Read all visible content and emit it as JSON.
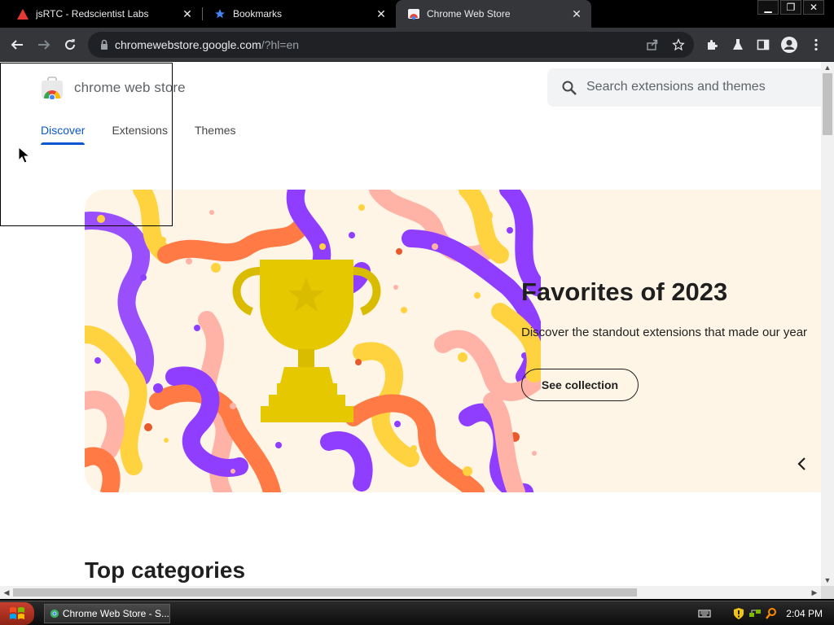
{
  "browser": {
    "tabs": [
      {
        "title": "jsRTC - Redscientist Labs",
        "favicon": "warning-triangle-icon",
        "active": false
      },
      {
        "title": "Bookmarks",
        "favicon": "star-icon",
        "active": false
      },
      {
        "title": "Chrome Web Store",
        "favicon": "chrome-web-store-icon",
        "active": true
      }
    ],
    "url_host": "chromewebstore.google.com",
    "url_path": "/?hl=en"
  },
  "store": {
    "name": "chrome web store",
    "search_placeholder": "Search extensions and themes",
    "nav": [
      "Discover",
      "Extensions",
      "Themes"
    ],
    "active_nav": "Discover"
  },
  "hero": {
    "title": "Favorites of 2023",
    "subtitle": "Discover the standout extensions that made our year",
    "button": "See collection"
  },
  "section": {
    "title": "Top categories"
  },
  "taskbar": {
    "item": "Chrome Web Store - S...",
    "clock": "2:04 PM"
  },
  "colors": {
    "accent": "#0b57d0",
    "hero_bg": "#fff5e6",
    "trophy": "#e6c800",
    "ribbon_purple": "#8f3dff",
    "ribbon_orange": "#ff7a45",
    "ribbon_yellow": "#ffd23f",
    "ribbon_pink": "#ffb3a7"
  }
}
